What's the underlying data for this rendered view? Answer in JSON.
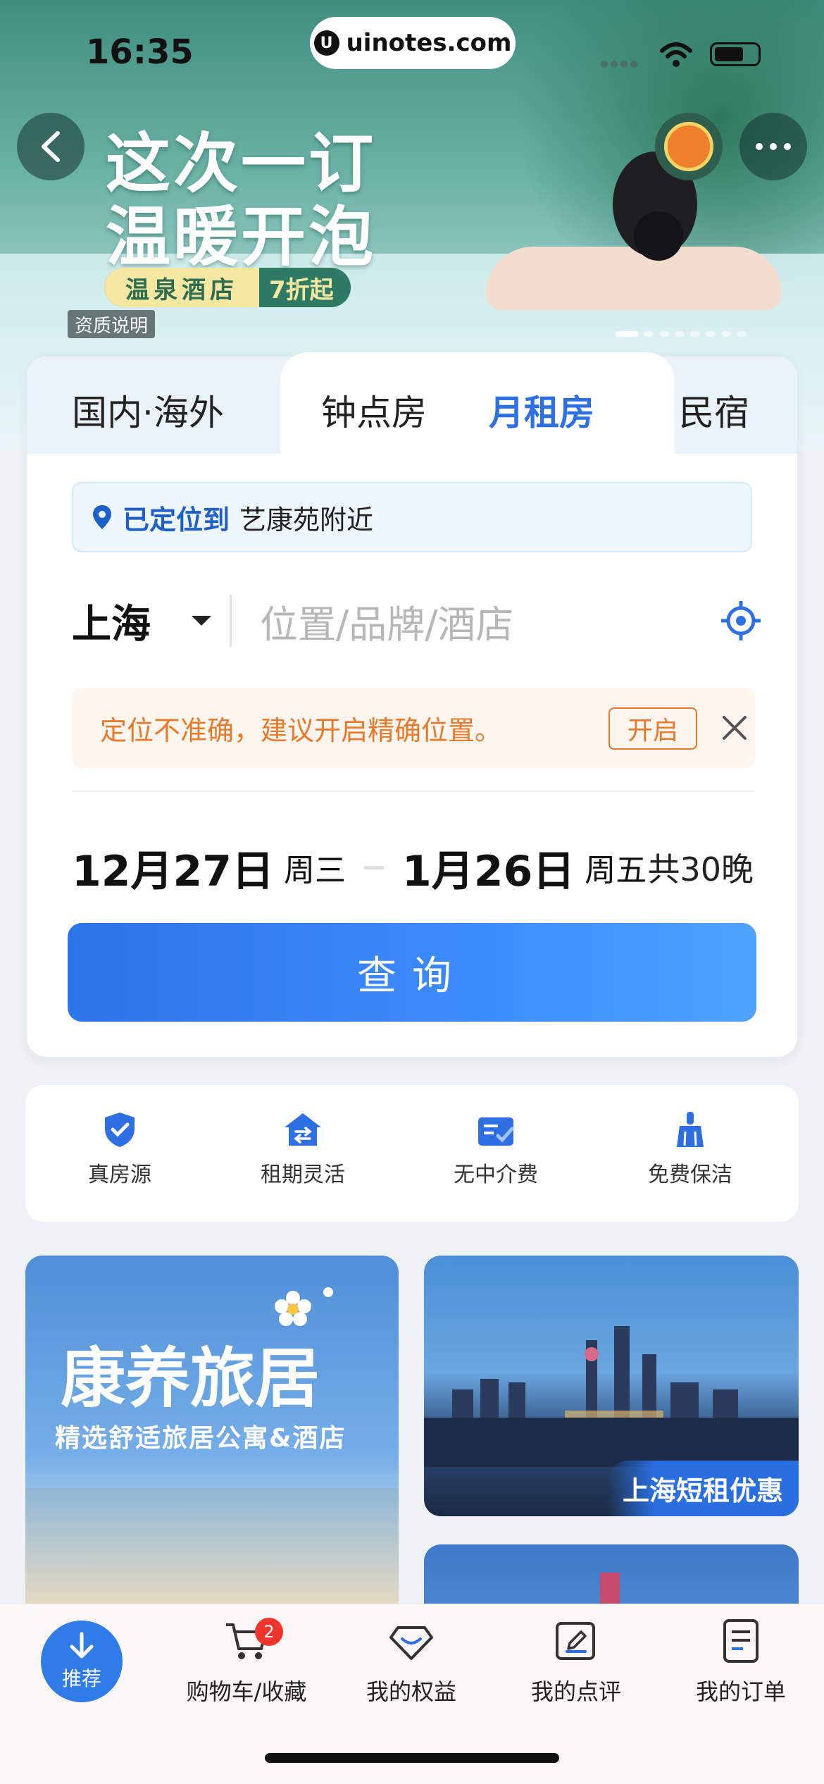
{
  "status_bar": {
    "time": "16:35",
    "url": "uinotes.com"
  },
  "hero": {
    "title_line1": "这次一订",
    "title_line2": "温暖开泡",
    "badge_left": "温泉酒店",
    "badge_right": "7折起",
    "qualification": "资质说明"
  },
  "tabs": [
    {
      "label": "国内·海外"
    },
    {
      "label": "钟点房"
    },
    {
      "label": "月租房"
    },
    {
      "label": "民宿"
    }
  ],
  "location_tip": {
    "prefix": "已定位到",
    "place": "艺康苑附近"
  },
  "search": {
    "city": "上海",
    "placeholder": "位置/品牌/酒店"
  },
  "warning": {
    "text": "定位不准确，建议开启精确位置。",
    "button": "开启"
  },
  "dates": {
    "checkin": "12月27日",
    "checkin_day": "周三",
    "checkout": "1月26日",
    "checkout_day": "周五",
    "nights": "共30晚"
  },
  "query_button": "查询",
  "features": [
    {
      "label": "真房源",
      "icon": "shield-check-icon"
    },
    {
      "label": "租期灵活",
      "icon": "house-swap-icon"
    },
    {
      "label": "无中介费",
      "icon": "card-check-icon"
    },
    {
      "label": "免费保洁",
      "icon": "broom-icon"
    }
  ],
  "promos": {
    "left_title": "康养旅居",
    "left_subtitle": "精选舒适旅居公寓&酒店",
    "right_tag": "上海短租优惠"
  },
  "bottom_nav": {
    "recommend": "推荐",
    "items": [
      {
        "label": "购物车/收藏",
        "icon": "cart-icon"
      },
      {
        "label": "我的权益",
        "icon": "diamond-icon"
      },
      {
        "label": "我的点评",
        "icon": "edit-icon"
      },
      {
        "label": "我的订单",
        "icon": "order-icon"
      }
    ],
    "cart_badge": "2"
  },
  "colors": {
    "accent": "#2f6fe4",
    "warning": "#e97a2b",
    "badge": "#f0352c"
  }
}
